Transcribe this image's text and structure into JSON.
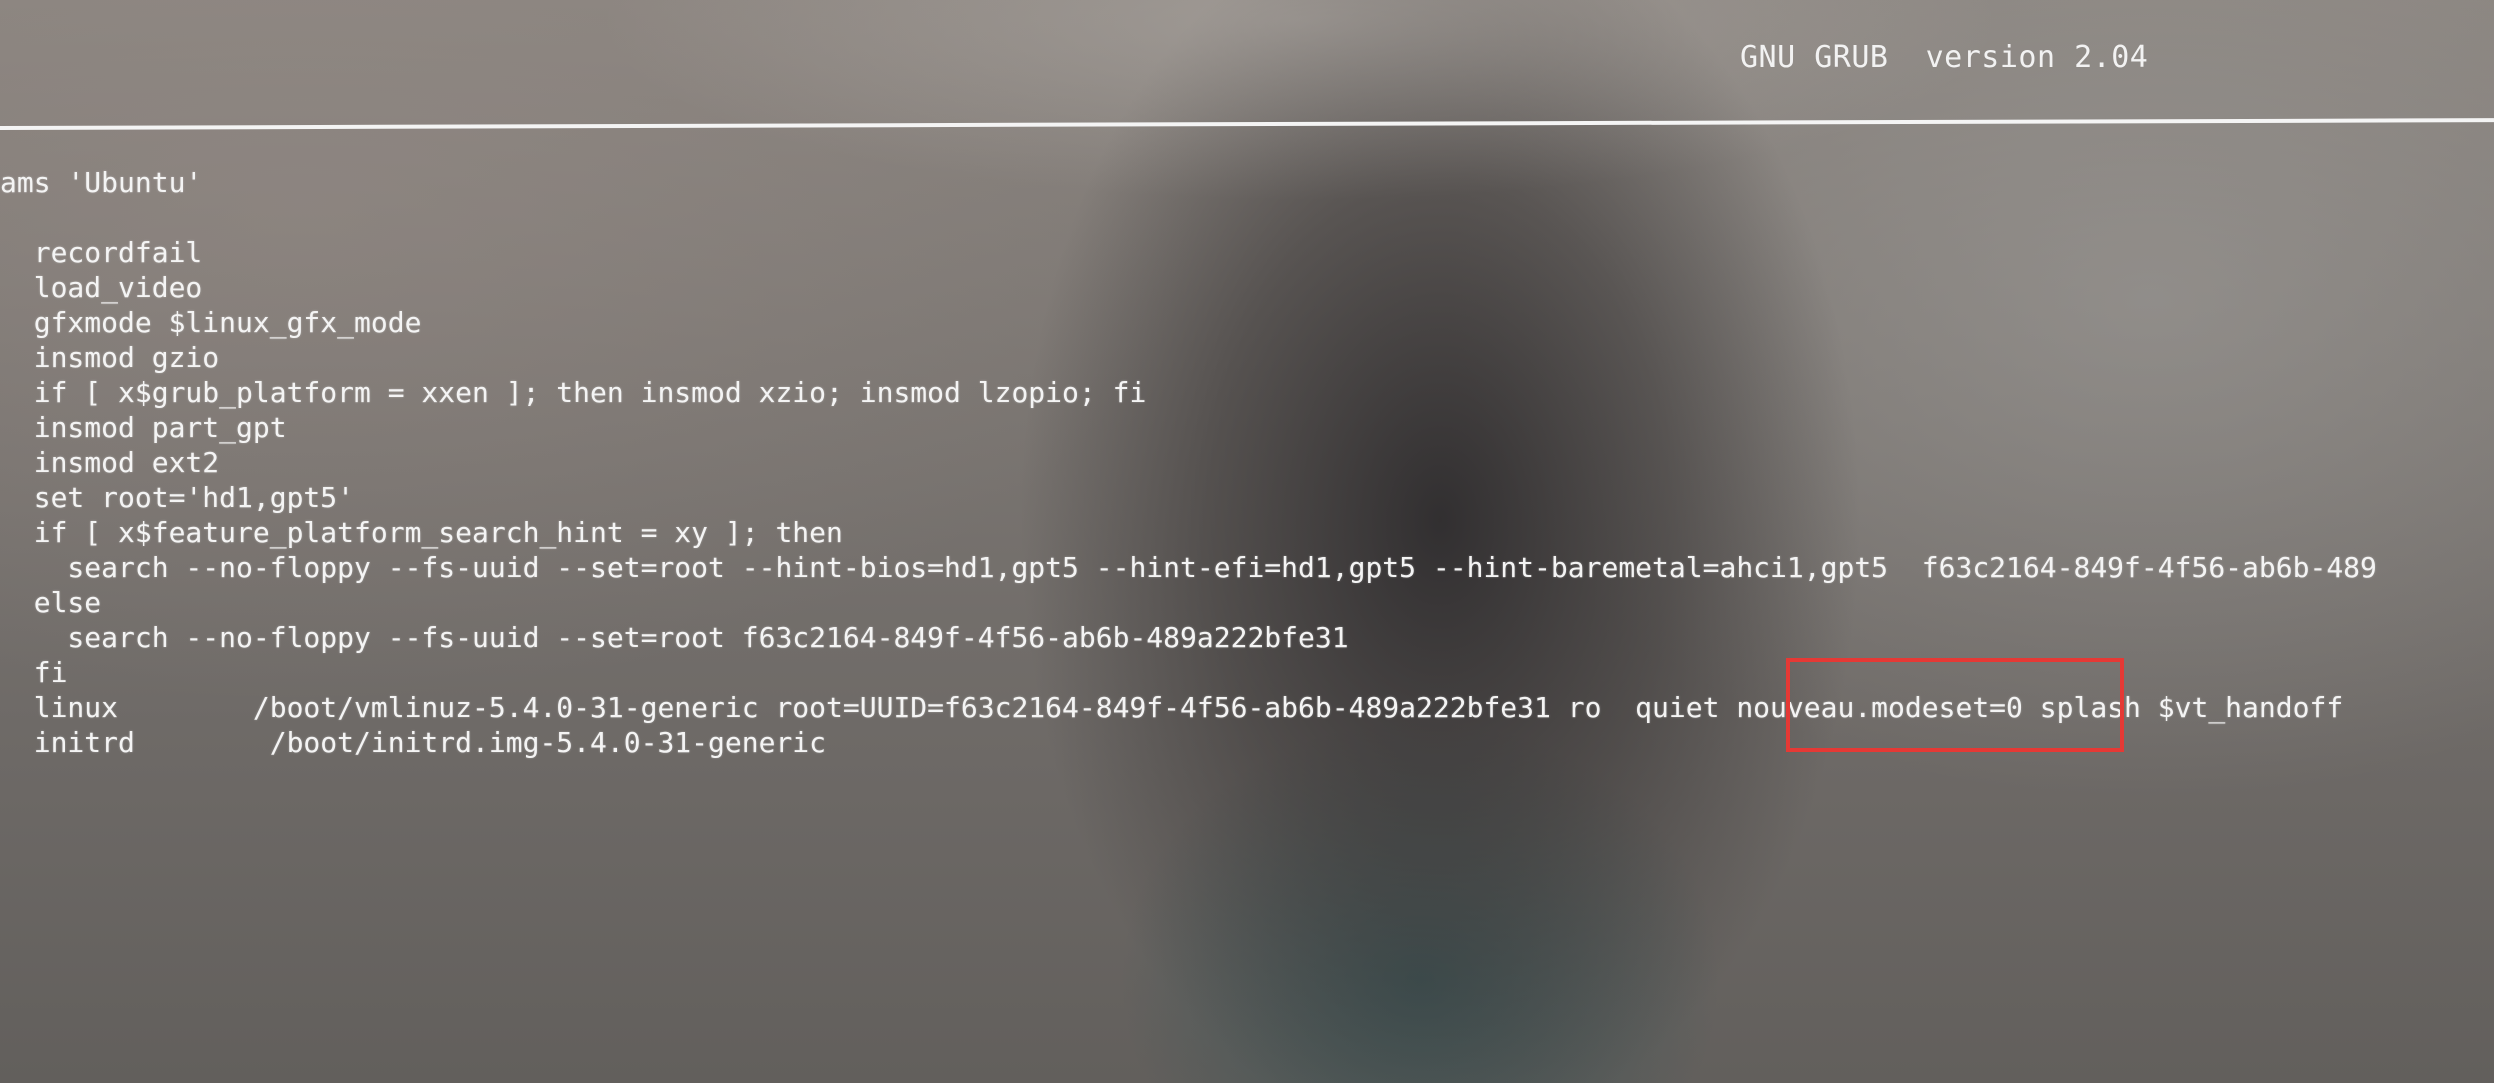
{
  "header": {
    "title": "GNU GRUB  version 2.04"
  },
  "editor": {
    "lines": [
      "ams 'Ubuntu'",
      "",
      "  recordfail",
      "  load_video",
      "  gfxmode $linux_gfx_mode",
      "  insmod gzio",
      "  if [ x$grub_platform = xxen ]; then insmod xzio; insmod lzopio; fi",
      "  insmod part_gpt",
      "  insmod ext2",
      "  set root='hd1,gpt5'",
      "  if [ x$feature_platform_search_hint = xy ]; then",
      "    search --no-floppy --fs-uuid --set=root --hint-bios=hd1,gpt5 --hint-efi=hd1,gpt5 --hint-baremetal=ahci1,gpt5  f63c2164-849f-4f56-ab6b-489",
      "  else",
      "    search --no-floppy --fs-uuid --set=root f63c2164-849f-4f56-ab6b-489a222bfe31",
      "  fi",
      "  linux        /boot/vmlinuz-5.4.0-31-generic root=UUID=f63c2164-849f-4f56-ab6b-489a222bfe31 ro  quiet nouveau.modeset=0 splash $vt_handoff",
      "  initrd        /boot/initrd.img-5.4.0-31-generic"
    ]
  },
  "annotation": {
    "color": "#e53935"
  }
}
